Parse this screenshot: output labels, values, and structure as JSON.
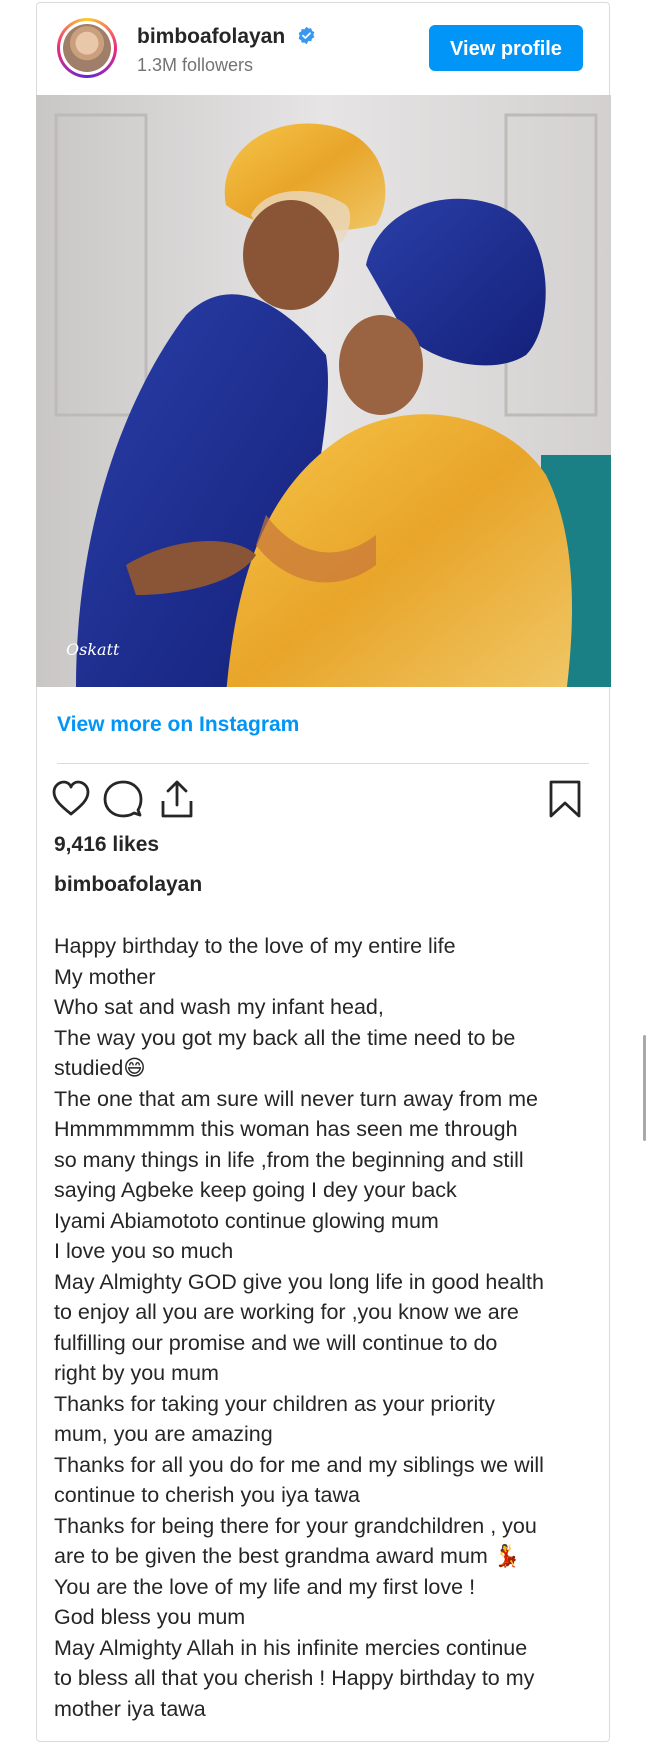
{
  "header": {
    "username": "bimboafolayan",
    "followers": "1.3M followers",
    "view_profile_label": "View profile"
  },
  "photo": {
    "watermark": "Oskatt"
  },
  "view_more_label": "View more on Instagram",
  "actions": {
    "like_icon": "heart-icon",
    "comment_icon": "comment-icon",
    "share_icon": "share-icon",
    "save_icon": "bookmark-icon"
  },
  "likes": "9,416 likes",
  "caption": {
    "username": "bimboafolayan",
    "lines": [
      "Happy birthday to the love of my entire life",
      "My mother",
      "Who sat and wash my infant head,",
      "The way you got my back all the time need to be",
      "studied😄",
      "The one that am sure will never turn away from me",
      "Hmmmmmmm this woman has seen me through",
      "so many things in life ,from the beginning and still",
      "saying Agbeke keep going I dey your back",
      "Iyami Abiamototo continue glowing mum",
      "I love you so much",
      "May Almighty GOD give you long life in good health",
      "to enjoy all you are working for ,you know we are",
      "fulfilling our promise and we will continue to do",
      "right by you mum",
      "Thanks for taking your children as your priority",
      "mum, you are amazing",
      "Thanks for all you do for me and my siblings we will",
      "continue to cherish you iya tawa",
      "Thanks for being there for your grandchildren , you",
      "are to be given the best grandma award mum 💃",
      "You are the love of my life and my first love !",
      "God bless you mum",
      "May Almighty Allah in his infinite mercies continue",
      "to bless all that you cherish ! Happy birthday to my",
      "mother iya tawa"
    ]
  },
  "colors": {
    "accent": "#0095f6",
    "text": "#262626",
    "muted": "#737373",
    "border": "#dbdbdb"
  }
}
